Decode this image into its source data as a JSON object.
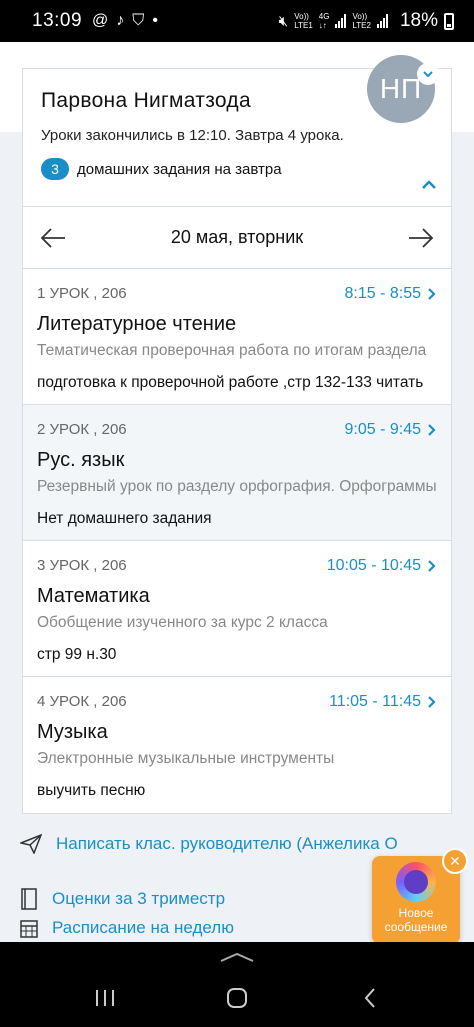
{
  "status_bar": {
    "time": "13:09",
    "battery": "18%",
    "sim1_label_top": "Vo))",
    "sim1_label_bottom": "LTE1",
    "network": "4G",
    "sim2_label_top": "Vo))",
    "sim2_label_bottom": "LTE2"
  },
  "header": {
    "student_name": "Парвона Нигматзода",
    "status_text": "Уроки закончились в 12:10. Завтра 4 урока.",
    "homework_count": "3",
    "homework_text": "домашних задания на завтра",
    "avatar_initials": "НП"
  },
  "date_nav": {
    "date": "20 мая, вторник"
  },
  "lessons": [
    {
      "meta": "1 УРОК , 206",
      "time": "8:15 - 8:55",
      "subject": "Литературное чтение",
      "topic": "Тематическая проверочная работа по итогам раздела",
      "homework": "подготовка к проверочной работе ,стр 132-133 читать"
    },
    {
      "meta": "2 УРОК , 206",
      "time": "9:05 - 9:45",
      "subject": "Рус. язык",
      "topic": "Резервный урок по разделу орфография. Орфограммы",
      "homework": "Нет домашнего задания"
    },
    {
      "meta": "3 УРОК , 206",
      "time": "10:05 - 10:45",
      "subject": "Математика",
      "topic": "Обобщение изученного за курс 2 класса",
      "homework": "стр 99 н.30"
    },
    {
      "meta": "4 УРОК , 206",
      "time": "11:05 - 11:45",
      "subject": "Музыка",
      "topic": "Электронные музыкальные инструменты",
      "homework": "выучить песню"
    }
  ],
  "links": {
    "write_teacher": "Написать клас. руководителю (Анжелика О",
    "grades": "Оценки за 3 триместр",
    "schedule": "Расписание на неделю"
  },
  "fab": {
    "label_line1": "Новое",
    "label_line2": "сообщение"
  },
  "colors": {
    "accent": "#1a8fc7",
    "fab": "#f4a032"
  }
}
